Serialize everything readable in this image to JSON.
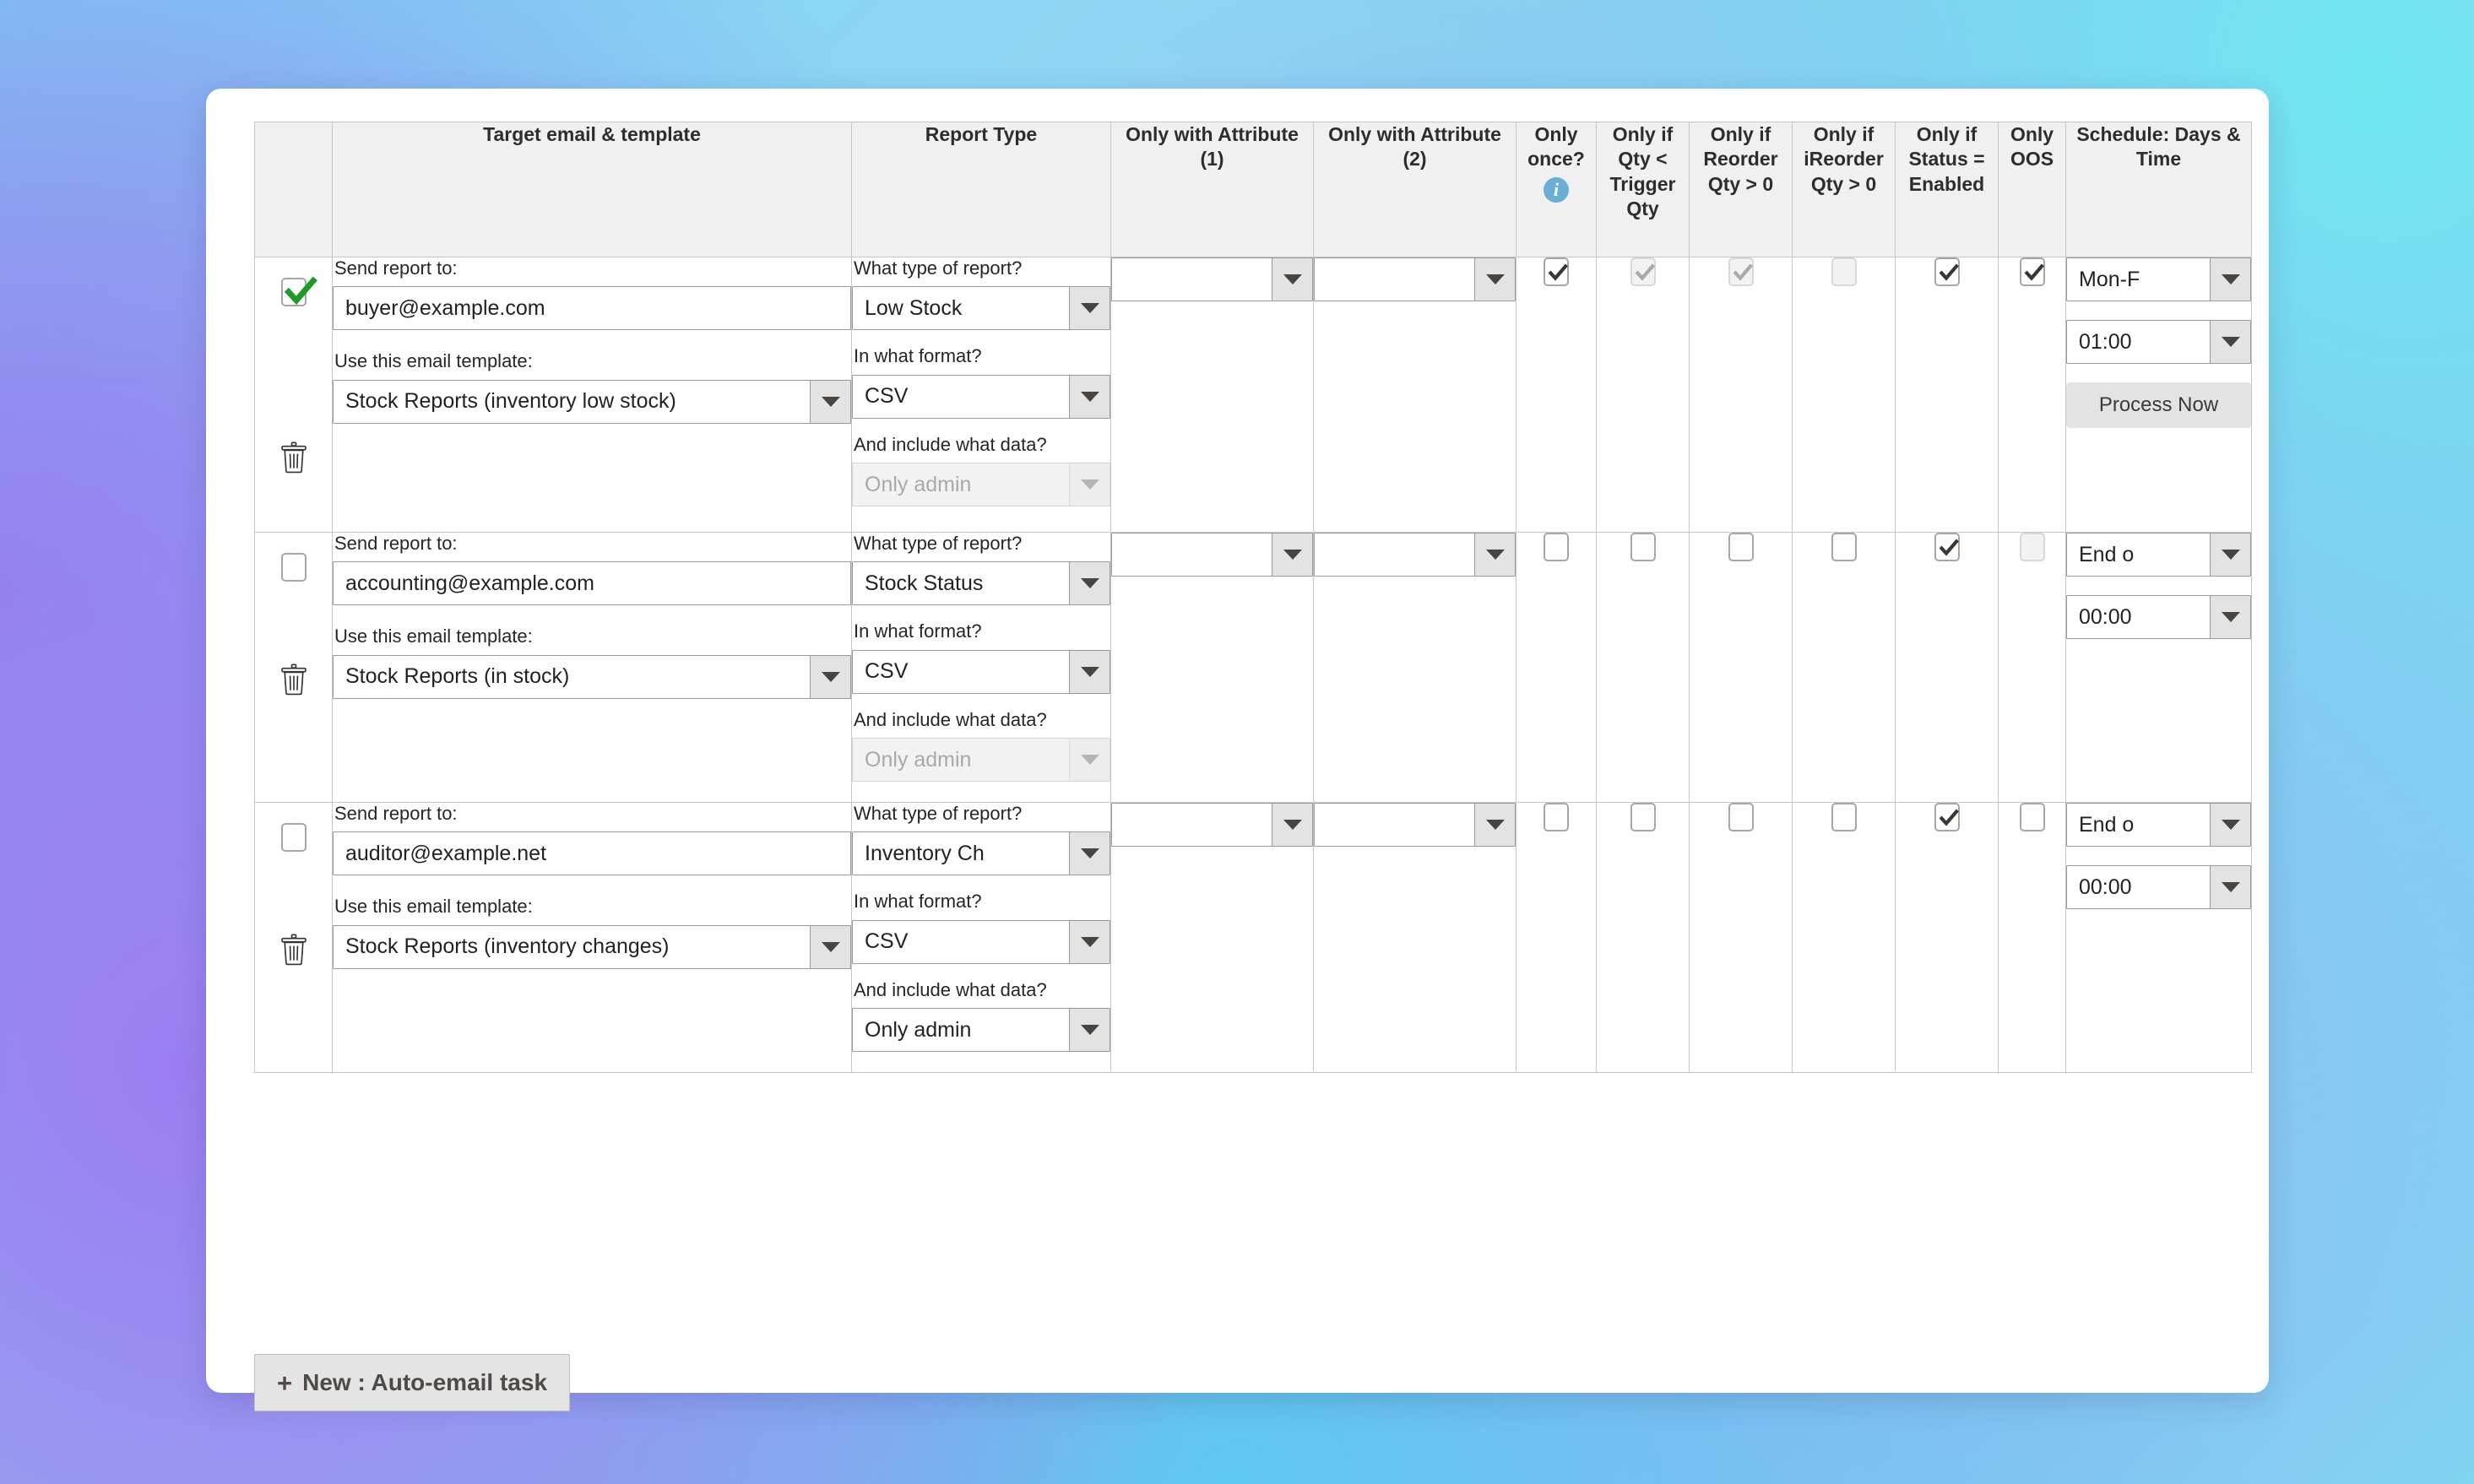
{
  "table": {
    "headers": {
      "enable": "",
      "target": "Target email & template",
      "report_type": "Report Type",
      "attr1": "Only with Attribute (1)",
      "attr2": "Only with Attribute (2)",
      "once": "Only once?",
      "qty_trigger": "Only if Qty < Trigger Qty",
      "reorder": "Only if Reorder Qty > 0",
      "ireorder": "Only if iReorder Qty > 0",
      "status_enabled": "Only if Status = Enabled",
      "oos": "Only OOS",
      "schedule": "Schedule: Days & Time"
    },
    "field_labels": {
      "send_report_to": "Send report to:",
      "use_template": "Use this email template:",
      "what_type": "What type of report?",
      "in_what_format": "In what format?",
      "include_what_data": "And include what data?"
    },
    "icons": {
      "info": "i",
      "delete": "trash-icon",
      "caret": "chevron-down-icon"
    },
    "rows": [
      {
        "enabled": true,
        "enabled_style": "green-check",
        "email": "buyer@example.com",
        "template": "Stock Reports (inventory low stock)",
        "report_type": "Low Stock",
        "format": "CSV",
        "include_data": "Only admin",
        "include_data_disabled": true,
        "attribute_1": "",
        "attribute_2": "",
        "only_once": {
          "checked": true,
          "disabled": false
        },
        "qty_trigger": {
          "checked": true,
          "disabled": true
        },
        "reorder_qty": {
          "checked": true,
          "disabled": true
        },
        "ireorder_qty": {
          "checked": false,
          "disabled": true
        },
        "status_enabled": {
          "checked": true,
          "disabled": false
        },
        "only_oos": {
          "checked": true,
          "disabled": false
        },
        "schedule_days": "Mon-F",
        "schedule_time": "01:00",
        "process_now_label": "Process Now",
        "has_process_now": true
      },
      {
        "enabled": false,
        "enabled_style": "plain",
        "email": "accounting@example.com",
        "template": "Stock Reports (in stock)",
        "report_type": "Stock Status",
        "format": "CSV",
        "include_data": "Only admin",
        "include_data_disabled": true,
        "attribute_1": "",
        "attribute_2": "",
        "only_once": {
          "checked": false,
          "disabled": false
        },
        "qty_trigger": {
          "checked": false,
          "disabled": false
        },
        "reorder_qty": {
          "checked": false,
          "disabled": false
        },
        "ireorder_qty": {
          "checked": false,
          "disabled": false
        },
        "status_enabled": {
          "checked": true,
          "disabled": false
        },
        "only_oos": {
          "checked": false,
          "disabled": true
        },
        "schedule_days": "End o",
        "schedule_time": "00:00",
        "process_now_label": "Process Now",
        "has_process_now": false
      },
      {
        "enabled": false,
        "enabled_style": "plain",
        "email": "auditor@example.net",
        "template": "Stock Reports (inventory changes)",
        "report_type": "Inventory Ch",
        "format": "CSV",
        "include_data": "Only admin",
        "include_data_disabled": false,
        "attribute_1": "",
        "attribute_2": "",
        "only_once": {
          "checked": false,
          "disabled": false
        },
        "qty_trigger": {
          "checked": false,
          "disabled": false
        },
        "reorder_qty": {
          "checked": false,
          "disabled": false
        },
        "ireorder_qty": {
          "checked": false,
          "disabled": false
        },
        "status_enabled": {
          "checked": true,
          "disabled": false
        },
        "only_oos": {
          "checked": false,
          "disabled": false
        },
        "schedule_days": "End o",
        "schedule_time": "00:00",
        "process_now_label": "Process Now",
        "has_process_now": false
      }
    ]
  },
  "footer": {
    "new_task_plus": "+",
    "new_task_label": "New : Auto-email task"
  },
  "colors": {
    "accent_info": "#6aaed6",
    "check_green": "#1f9a26",
    "header_bg": "#f0f0f0",
    "border": "#c6c6c6"
  }
}
